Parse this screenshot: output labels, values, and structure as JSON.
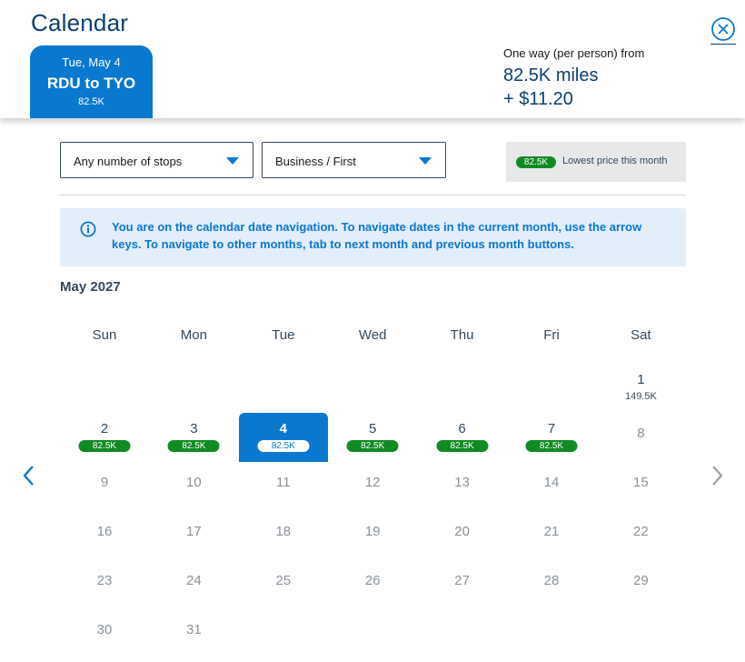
{
  "header": {
    "title": "Calendar",
    "selected_tab": {
      "date": "Tue, May 4",
      "route": "RDU to TYO",
      "price": "82.5K"
    },
    "price_summary": {
      "from_label": "One way (per person) from",
      "miles": "82.5K miles",
      "fee": "+ $11.20"
    },
    "close_icon": "close-circle-icon"
  },
  "filters": {
    "stops": "Any number of stops",
    "cabin": "Business / First",
    "legend": {
      "pill": "82.5K",
      "text": "Lowest price this month"
    }
  },
  "info": {
    "icon": "info-circle-icon",
    "text": "You are on the calendar date navigation. To navigate dates in the current month, use the arrow keys. To navigate to other months, tab to next month and previous month buttons."
  },
  "calendar": {
    "month": "May 2027",
    "weekdays": [
      "Sun",
      "Mon",
      "Tue",
      "Wed",
      "Thu",
      "Fri",
      "Sat"
    ],
    "days": [
      {
        "day": "1",
        "price": "149.5K",
        "lowest": false,
        "available": true,
        "col": 6,
        "row": 0
      },
      {
        "day": "2",
        "price": "82.5K",
        "lowest": true,
        "available": true,
        "col": 0,
        "row": 1
      },
      {
        "day": "3",
        "price": "82.5K",
        "lowest": true,
        "available": true,
        "col": 1,
        "row": 1
      },
      {
        "day": "4",
        "price": "82.5K",
        "lowest": true,
        "available": true,
        "selected": true,
        "col": 2,
        "row": 1
      },
      {
        "day": "5",
        "price": "82.5K",
        "lowest": true,
        "available": true,
        "col": 3,
        "row": 1
      },
      {
        "day": "6",
        "price": "82.5K",
        "lowest": true,
        "available": true,
        "col": 4,
        "row": 1
      },
      {
        "day": "7",
        "price": "82.5K",
        "lowest": true,
        "available": true,
        "col": 5,
        "row": 1
      },
      {
        "day": "8",
        "available": false,
        "col": 6,
        "row": 1
      },
      {
        "day": "9",
        "available": false,
        "col": 0,
        "row": 2
      },
      {
        "day": "10",
        "available": false,
        "col": 1,
        "row": 2
      },
      {
        "day": "11",
        "available": false,
        "col": 2,
        "row": 2
      },
      {
        "day": "12",
        "available": false,
        "col": 3,
        "row": 2
      },
      {
        "day": "13",
        "available": false,
        "col": 4,
        "row": 2
      },
      {
        "day": "14",
        "available": false,
        "col": 5,
        "row": 2
      },
      {
        "day": "15",
        "available": false,
        "col": 6,
        "row": 2
      },
      {
        "day": "16",
        "available": false,
        "col": 0,
        "row": 3
      },
      {
        "day": "17",
        "available": false,
        "col": 1,
        "row": 3
      },
      {
        "day": "18",
        "available": false,
        "col": 2,
        "row": 3
      },
      {
        "day": "19",
        "available": false,
        "col": 3,
        "row": 3
      },
      {
        "day": "20",
        "available": false,
        "col": 4,
        "row": 3
      },
      {
        "day": "21",
        "available": false,
        "col": 5,
        "row": 3
      },
      {
        "day": "22",
        "available": false,
        "col": 6,
        "row": 3
      },
      {
        "day": "23",
        "available": false,
        "col": 0,
        "row": 4
      },
      {
        "day": "24",
        "available": false,
        "col": 1,
        "row": 4
      },
      {
        "day": "25",
        "available": false,
        "col": 2,
        "row": 4
      },
      {
        "day": "26",
        "available": false,
        "col": 3,
        "row": 4
      },
      {
        "day": "27",
        "available": false,
        "col": 4,
        "row": 4
      },
      {
        "day": "28",
        "available": false,
        "col": 5,
        "row": 4
      },
      {
        "day": "29",
        "available": false,
        "col": 6,
        "row": 4
      },
      {
        "day": "30",
        "available": false,
        "col": 0,
        "row": 5
      },
      {
        "day": "31",
        "available": false,
        "col": 1,
        "row": 5
      }
    ],
    "prev_icon": "chevron-left-icon",
    "next_icon": "chevron-right-icon"
  },
  "colors": {
    "accent": "#0b78d0",
    "navy": "#0b3f74",
    "lowest_price": "#128a24",
    "banner": "#e3eefb"
  }
}
